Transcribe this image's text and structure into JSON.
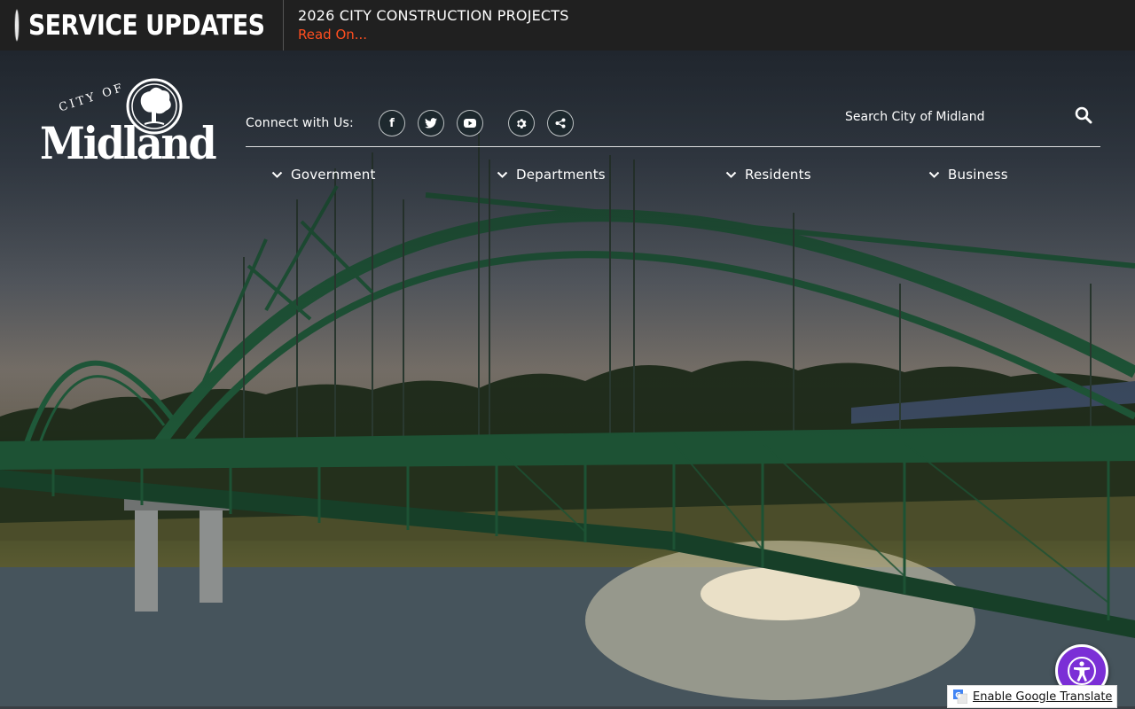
{
  "alert": {
    "title": "SERVICE UPDATES",
    "headline": "2026 CITY CONSTRUCTION PROJECTS",
    "link": "Read On..."
  },
  "logo": {
    "city_of": "CITY OF",
    "name": "Midland"
  },
  "connect": {
    "label": "Connect with Us:",
    "icons": [
      "facebook-icon",
      "twitter-icon",
      "youtube-icon",
      "settings-icon",
      "share-icon"
    ]
  },
  "search": {
    "placeholder": "Search City of Midland"
  },
  "nav": {
    "items": [
      {
        "label": "Government"
      },
      {
        "label": "Departments"
      },
      {
        "label": "Residents"
      },
      {
        "label": "Business"
      }
    ]
  },
  "translate": {
    "label": "Enable Google Translate"
  },
  "colors": {
    "alert_bg": "#202020",
    "alert_link": "#ff4e1f",
    "accessibility_purple": "#7b2fd6",
    "bridge_green": "#1f5a3a"
  }
}
